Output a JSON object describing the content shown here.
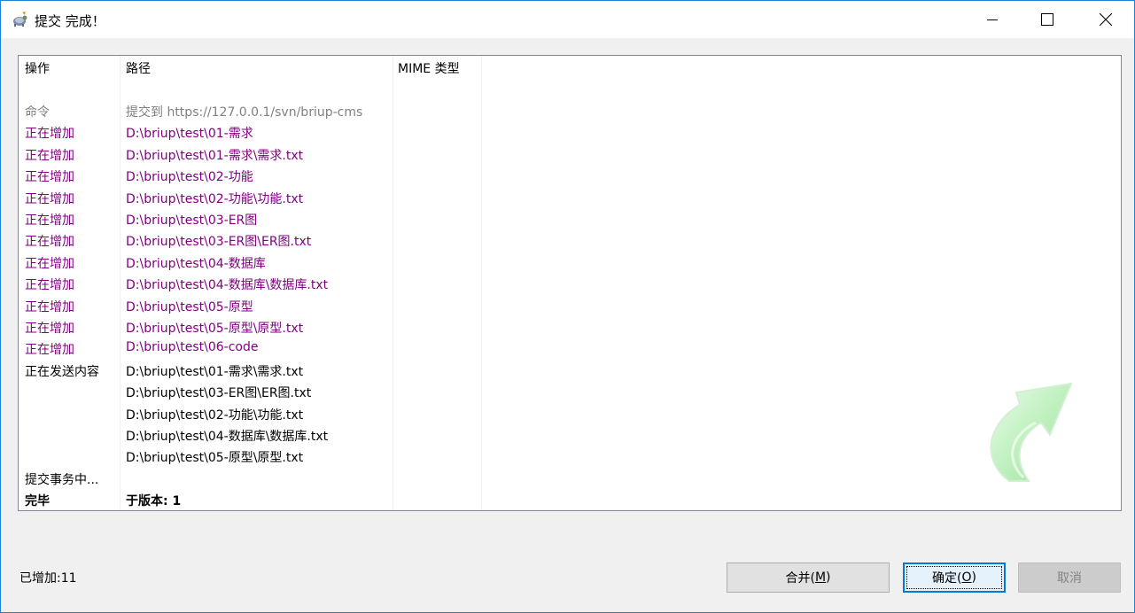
{
  "window": {
    "title": "提交 完成！"
  },
  "list": {
    "headers": {
      "action": "操作",
      "path": "路径",
      "mime": "MIME 类型"
    },
    "rows": [
      {
        "action": "命令",
        "path": "提交到 https://127.0.0.1/svn/briup-cms",
        "kind": "cmd"
      },
      {
        "action": "正在增加",
        "path": "D:\\briup\\test\\01-需求",
        "kind": "add"
      },
      {
        "action": "正在增加",
        "path": "D:\\briup\\test\\01-需求\\需求.txt",
        "kind": "add"
      },
      {
        "action": "正在增加",
        "path": "D:\\briup\\test\\02-功能",
        "kind": "add"
      },
      {
        "action": "正在增加",
        "path": "D:\\briup\\test\\02-功能\\功能.txt",
        "kind": "add"
      },
      {
        "action": "正在增加",
        "path": "D:\\briup\\test\\03-ER图",
        "kind": "add"
      },
      {
        "action": "正在增加",
        "path": "D:\\briup\\test\\03-ER图\\ER图.txt",
        "kind": "add"
      },
      {
        "action": "正在增加",
        "path": "D:\\briup\\test\\04-数据库",
        "kind": "add"
      },
      {
        "action": "正在增加",
        "path": "D:\\briup\\test\\04-数据库\\数据库.txt",
        "kind": "add"
      },
      {
        "action": "正在增加",
        "path": "D:\\briup\\test\\05-原型",
        "kind": "add"
      },
      {
        "action": "正在增加",
        "path": "D:\\briup\\test\\05-原型\\原型.txt",
        "kind": "add"
      },
      {
        "action": "正在增加",
        "path": "D:\\briup\\test\\06-code",
        "kind": "add"
      },
      {
        "action": "正在发送内容",
        "path": "D:\\briup\\test\\01-需求\\需求.txt",
        "kind": "send"
      },
      {
        "action": "",
        "path": "D:\\briup\\test\\03-ER图\\ER图.txt",
        "kind": "send"
      },
      {
        "action": "",
        "path": "D:\\briup\\test\\02-功能\\功能.txt",
        "kind": "send"
      },
      {
        "action": "",
        "path": "D:\\briup\\test\\04-数据库\\数据库.txt",
        "kind": "send"
      },
      {
        "action": "",
        "path": "D:\\briup\\test\\05-原型\\原型.txt",
        "kind": "send"
      },
      {
        "action": "提交事务中...",
        "path": "",
        "kind": "send"
      },
      {
        "action": "完毕",
        "path": "于版本: 1",
        "kind": "done"
      }
    ]
  },
  "status": {
    "added": "已增加:11"
  },
  "buttons": {
    "merge": {
      "label": "合并(",
      "mnemonic": "M",
      "suffix": ")"
    },
    "ok": {
      "label": "确定(",
      "mnemonic": "O",
      "suffix": ")"
    },
    "cancel": {
      "label": "取消"
    }
  },
  "colors": {
    "command": "#808080",
    "adding": "#800080",
    "normal": "#000000",
    "accent": "#0078d7",
    "arrow": "#8fe08f"
  },
  "icons": {
    "app": "tortoise-svn-icon",
    "minimize": "minimize-icon",
    "maximize": "maximize-icon",
    "close": "close-icon",
    "watermark": "commit-arrow-icon"
  }
}
